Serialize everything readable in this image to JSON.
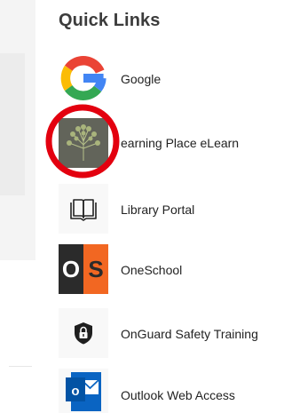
{
  "section": {
    "title": "Quick Links"
  },
  "links": [
    {
      "label": "Google",
      "icon": "google-icon"
    },
    {
      "label": "earning Place eLearn",
      "icon": "learning-place-tree-icon"
    },
    {
      "label": "Library Portal",
      "icon": "book-icon"
    },
    {
      "label": "OneSchool",
      "icon": "oneschool-icon",
      "icon_text": "OS"
    },
    {
      "label": "OnGuard Safety Training",
      "icon": "shield-lock-icon"
    },
    {
      "label": "Outlook Web Access",
      "icon": "outlook-icon",
      "icon_text": "o"
    }
  ],
  "annotation": {
    "shape": "circle-outline",
    "color": "#e3000f"
  },
  "colors": {
    "google_blue": "#4285f4",
    "google_red": "#ea4335",
    "google_yellow": "#fbbc05",
    "google_green": "#34a853",
    "oneschool_dark": "#2b2b2b",
    "oneschool_orange": "#f26722",
    "outlook_blue": "#0a64c2"
  }
}
